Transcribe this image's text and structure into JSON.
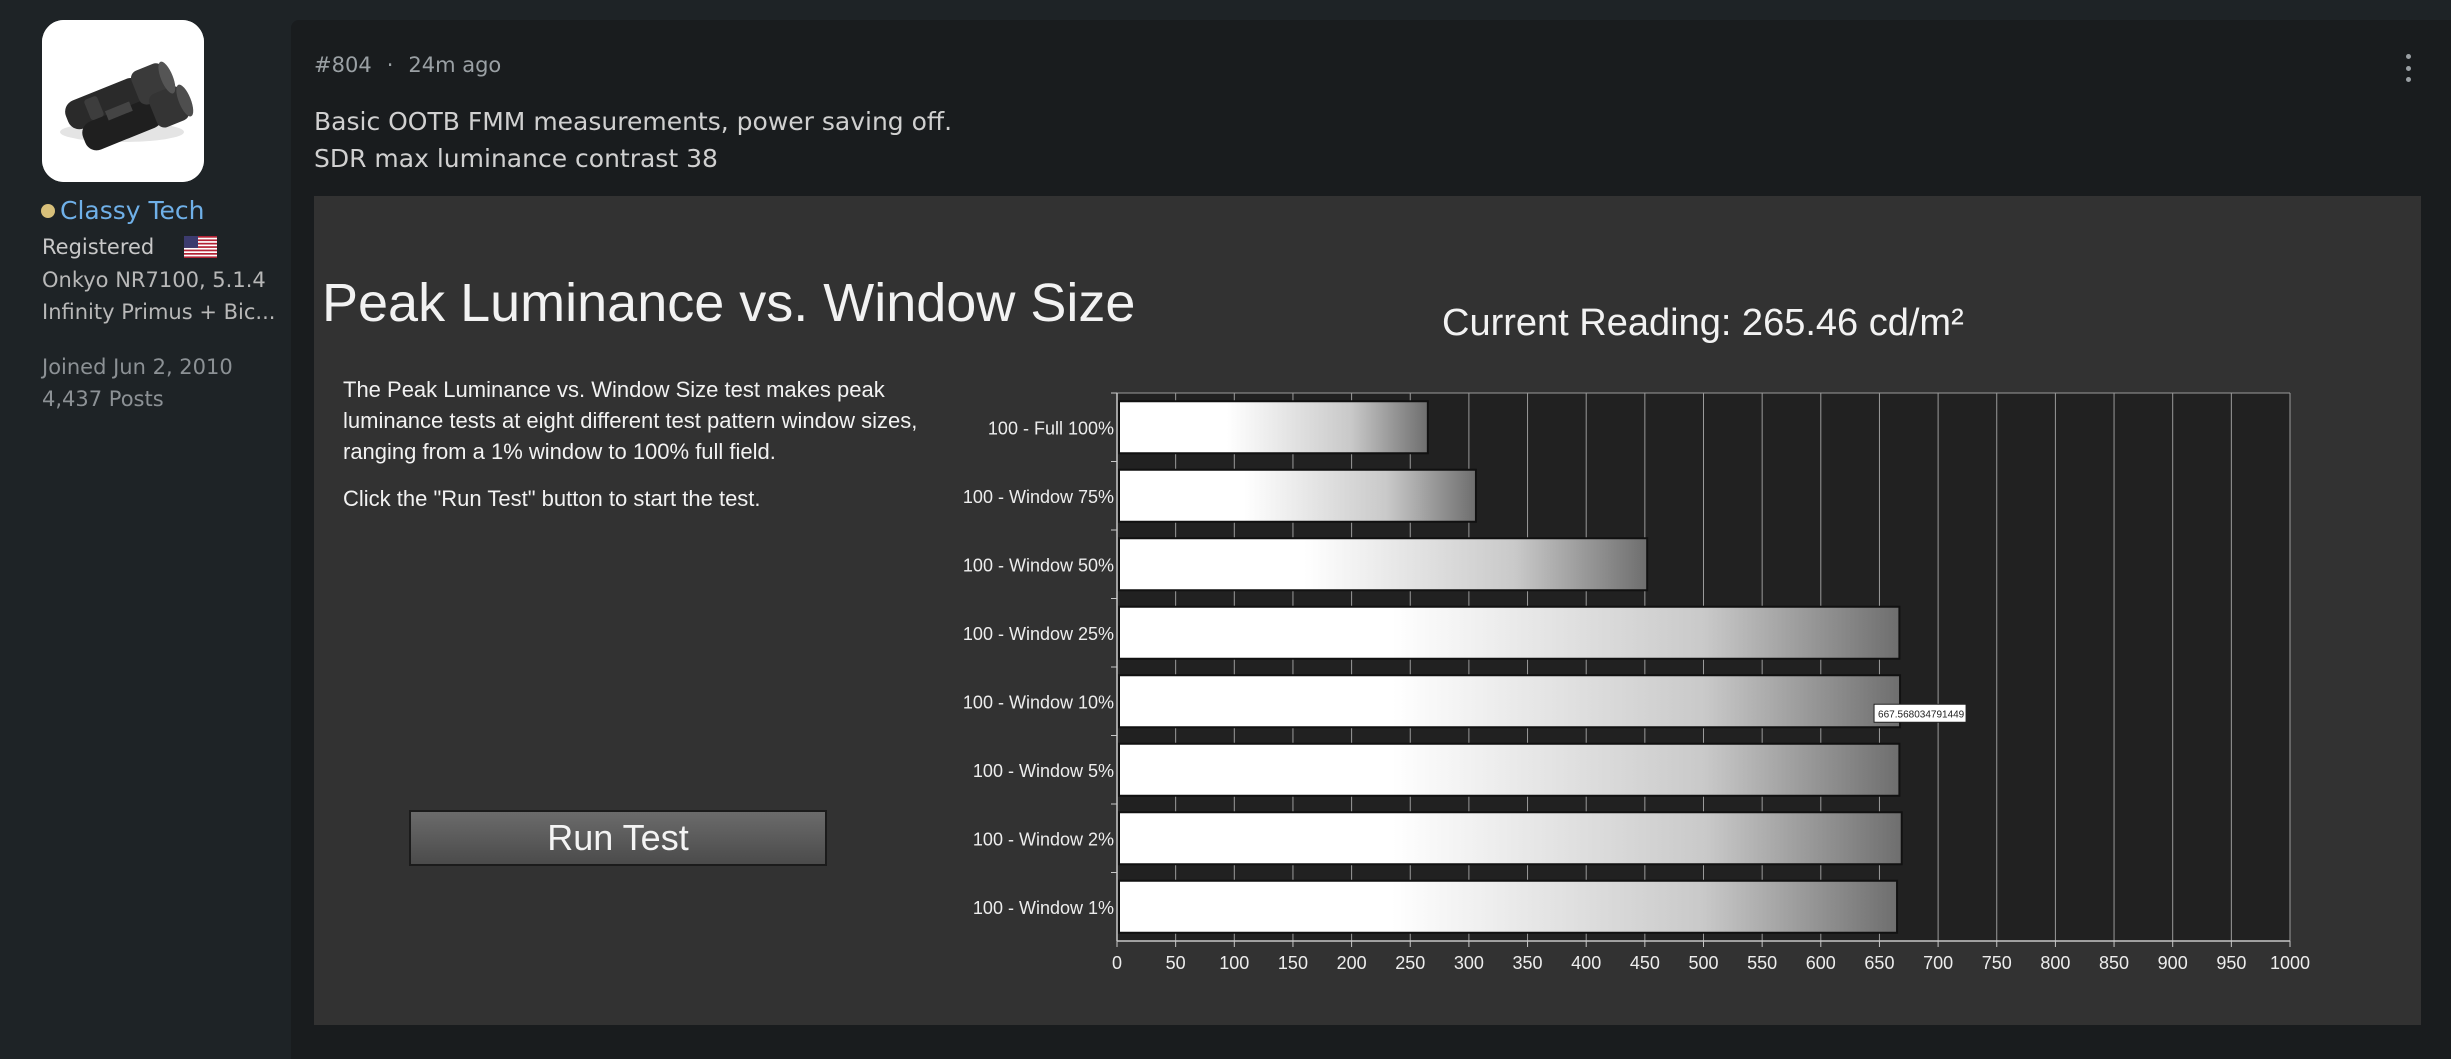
{
  "user": {
    "name": "Classy Tech",
    "role": "Registered",
    "signature": [
      "Onkyo NR7100, 5.1.4",
      "Infinity Primus + Bic..."
    ],
    "joined": "Joined Jun 2, 2010",
    "posts": "4,437 Posts",
    "status_color": "#d8c07a",
    "name_color": "#6fb0e8"
  },
  "post": {
    "number": "#804",
    "separator": "·",
    "time": "24m ago",
    "lines": [
      "Basic OOTB FMM measurements, power saving off.",
      "SDR max luminance contrast 38"
    ]
  },
  "screenshot": {
    "title": "Peak Luminance vs. Window Size",
    "description": "The Peak Luminance vs. Window Size test makes peak luminance tests at eight different test pattern window sizes, ranging from a 1% window to 100% full field.",
    "instruction": "Click the \"Run Test\" button to start the test.",
    "run_button": "Run Test",
    "current_reading": "Current Reading: 265.46 cd/m²"
  },
  "chart_data": {
    "type": "bar",
    "orientation": "horizontal",
    "categories": [
      "100 - Full  100%",
      "100 - Window 75%",
      "100 - Window 50%",
      "100 - Window 25%",
      "100 - Window 10%",
      "100 - Window  5%",
      "100 - Window  2%",
      "100 - Window  1%"
    ],
    "values": [
      265,
      306,
      452,
      667,
      667.568034791449,
      667,
      669,
      665
    ],
    "xlim": [
      0,
      1000
    ],
    "ticks": [
      0,
      50,
      100,
      150,
      200,
      250,
      300,
      350,
      400,
      450,
      500,
      550,
      600,
      650,
      700,
      750,
      800,
      850,
      900,
      950,
      1000
    ],
    "grid": true,
    "tooltip": {
      "category_index": 4,
      "text": "667.568034791449"
    }
  }
}
